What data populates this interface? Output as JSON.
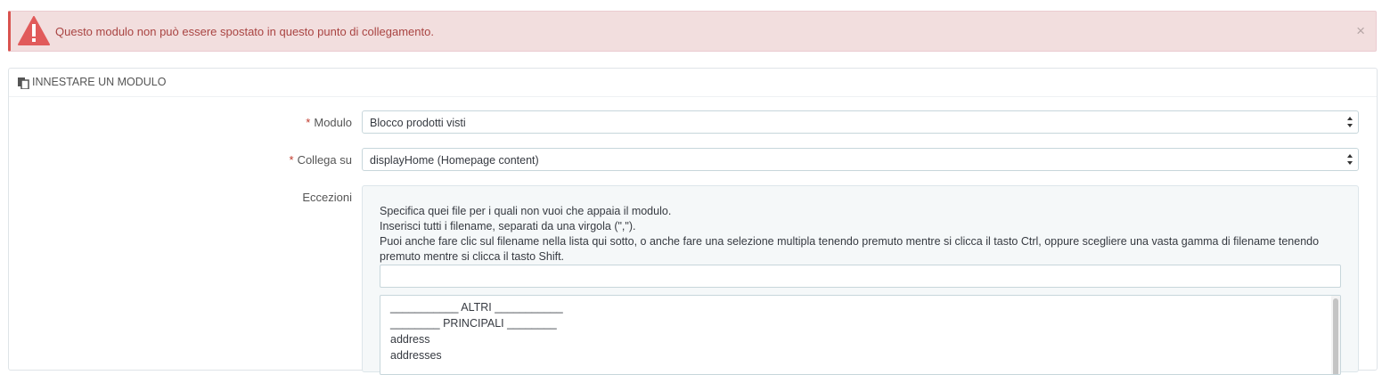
{
  "alert": {
    "message": "Questo modulo non può essere spostato in questo punto di collegamento.",
    "close": "×",
    "color": "#a94442"
  },
  "panel": {
    "title": "INNESTARE UN MODULO",
    "icon": "paste-icon"
  },
  "form": {
    "required_marker": "*",
    "module_label": "Modulo",
    "module_value": "Blocco prodotti visti",
    "hook_label": "Collega su",
    "hook_value": "displayHome (Homepage content)",
    "exceptions_label": "Eccezioni",
    "help_lines": [
      "Specifica quei file per i quali non vuoi che appaia il modulo.",
      "Inserisci tutti i filename, separati da una virgola (\",\").",
      "Puoi anche fare clic sul filename nella lista qui sotto, o anche fare una selezione multipla tenendo premuto mentre si clicca il tasto Ctrl, oppure scegliere una vasta gamma di filename tenendo premuto mentre si clicca il tasto Shift."
    ],
    "exceptions_input_value": "",
    "exceptions_options": [
      "___________ ALTRI ___________",
      "________ PRINCIPALI ________",
      "address",
      "addresses"
    ]
  },
  "colors": {
    "required": "#c0392b",
    "alert_bg": "#f2dede",
    "alert_icon": "#e15b5b"
  }
}
